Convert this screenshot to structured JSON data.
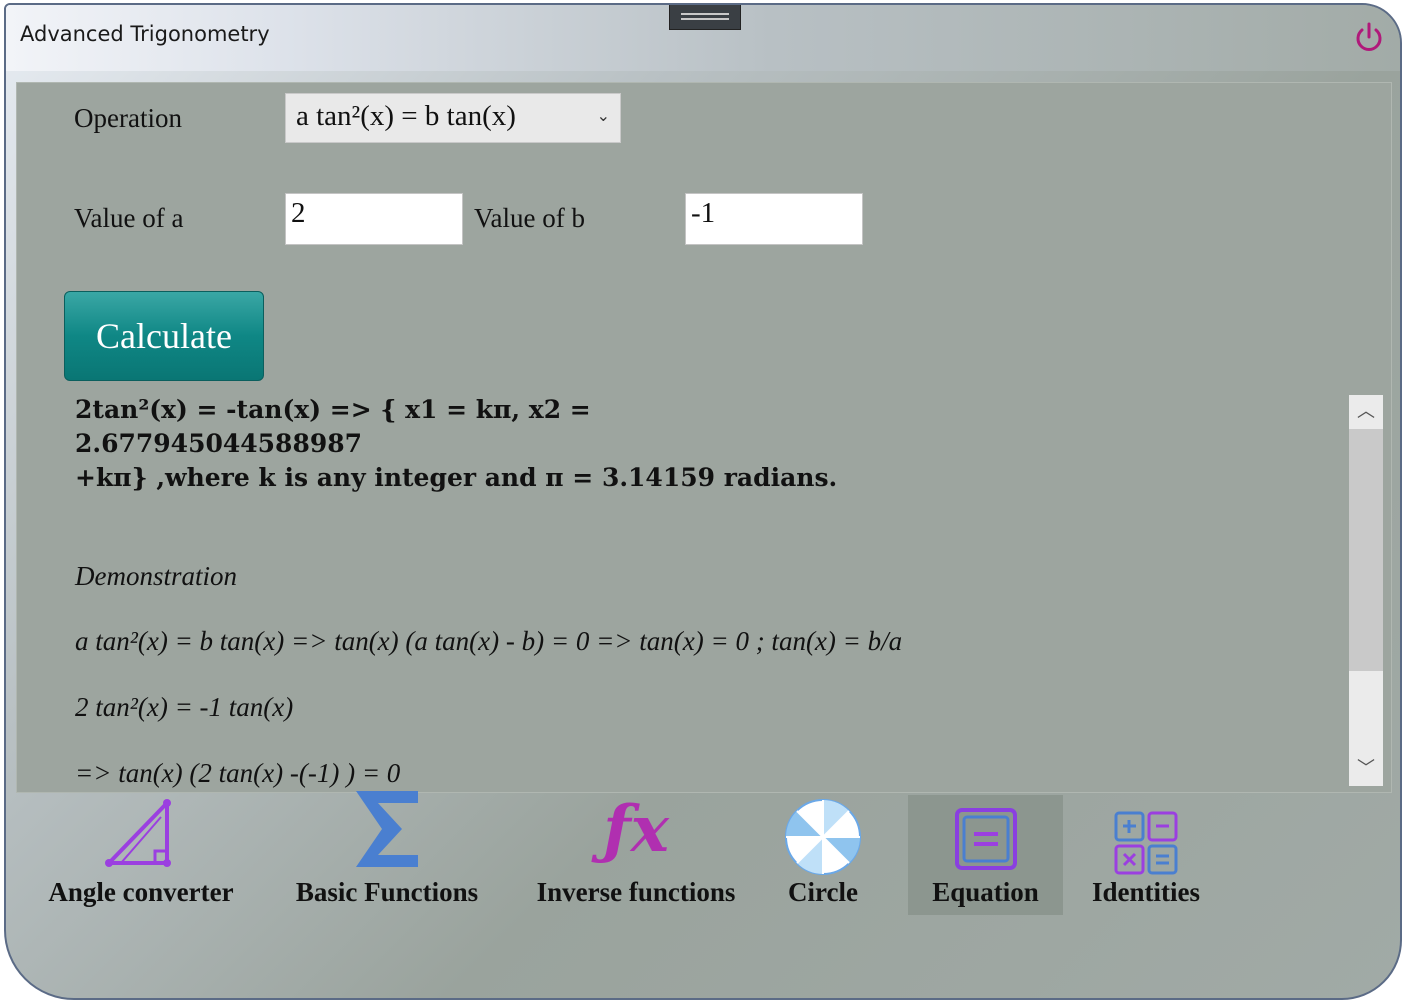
{
  "window": {
    "title": "Advanced Trigonometry"
  },
  "form": {
    "operation_label": "Operation",
    "operation_value": "a tan²(x) = b tan(x)",
    "a_label": "Value of a",
    "a_value": "2",
    "b_label": "Value of b",
    "b_value": "-1",
    "calculate_label": "Calculate"
  },
  "result": {
    "line1": "2tan²(x) = -tan(x) => { x1 = kπ, x2 = 2.677945044588987",
    "line2": "+kπ} ,where k is any integer and π = 3.14159 radians."
  },
  "demonstration": {
    "heading": "Demonstration",
    "step1": "a tan²(x) = b tan(x) => tan(x) (a tan(x) - b) = 0 => tan(x) = 0 ; tan(x) = b/a",
    "step2": "2 tan²(x) = -1 tan(x)",
    "step3": "=> tan(x) (2 tan(x) -(-1) ) = 0"
  },
  "nav": {
    "items": [
      {
        "label": "Angle converter",
        "icon": "angle-icon",
        "active": false
      },
      {
        "label": "Basic Functions",
        "icon": "sigma-icon",
        "active": false
      },
      {
        "label": "Inverse functions",
        "icon": "fx-icon",
        "active": false
      },
      {
        "label": "Circle",
        "icon": "circle-icon",
        "active": false
      },
      {
        "label": "Equation",
        "icon": "equation-icon",
        "active": true
      },
      {
        "label": "Identities",
        "icon": "calculator-icon",
        "active": false
      }
    ]
  },
  "colors": {
    "accent": "#0f8785",
    "power": "#b0197a",
    "icon_purple": "#9b3fe0",
    "icon_blue": "#4a7fd0"
  }
}
